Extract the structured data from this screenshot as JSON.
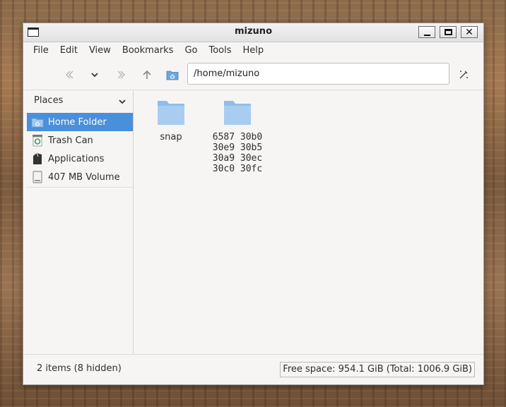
{
  "window": {
    "title": "mizuno"
  },
  "menubar": [
    "File",
    "Edit",
    "View",
    "Bookmarks",
    "Go",
    "Tools",
    "Help"
  ],
  "toolbar": {
    "address": "/home/mizuno"
  },
  "sidebar": {
    "heading": "Places",
    "items": [
      {
        "label": "Home Folder",
        "icon": "home-folder-icon",
        "selected": true
      },
      {
        "label": "Trash Can",
        "icon": "trash-icon",
        "selected": false
      },
      {
        "label": "Applications",
        "icon": "applications-icon",
        "selected": false
      },
      {
        "label": "407 MB Volume",
        "icon": "drive-icon",
        "selected": false
      }
    ]
  },
  "files": [
    {
      "name": "snap"
    },
    {
      "name": "6587 30b0 30e9 30b5 30a9 30ec 30c0 30fc"
    }
  ],
  "status": {
    "items": "2 items (8 hidden)",
    "free_space": "Free space: 954.1 GiB (Total: 1006.9 GiB)"
  },
  "colors": {
    "selection": "#4a8fd9",
    "folder": "#8fbde9"
  }
}
